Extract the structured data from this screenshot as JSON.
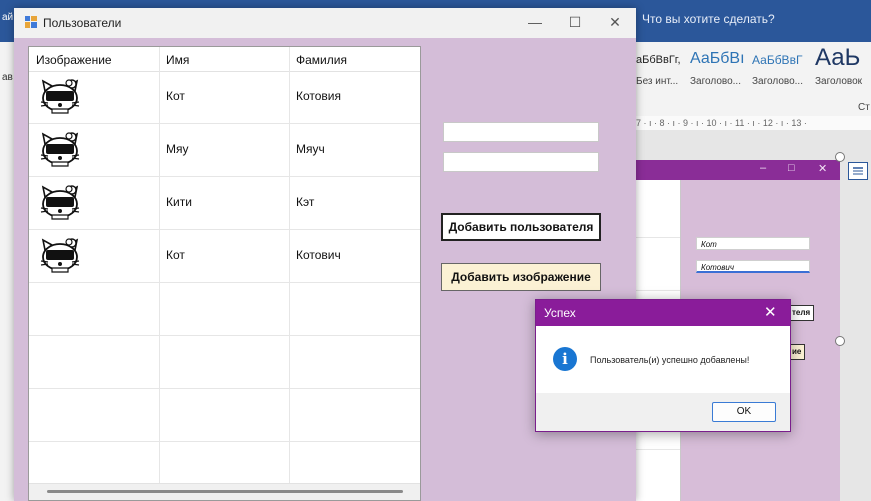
{
  "word": {
    "search_placeholder": "Что вы хотите сделать?",
    "left_labels": [
      "ай",
      "ав"
    ],
    "styles": [
      {
        "sample": "аБбВвГг,",
        "name": "Без инт..."
      },
      {
        "sample": "АаБбВı",
        "name": "Заголово..."
      },
      {
        "sample": "АаБбВвГ",
        "name": "Заголово..."
      },
      {
        "sample": "АаЬ",
        "name": "Заголовок"
      }
    ],
    "ribbon_right_label": "Ст",
    "ruler_text": "7 · ı · 8 · ı · 9 · ı · 10 · ı · 11 · ı · 12 · ı · 13 ·",
    "embedded": {
      "controls": [
        "–",
        "□",
        "✕"
      ],
      "first_name": "Кот",
      "last_name": "Котович",
      "btn1_fragment": "теля",
      "btn2_fragment": "ие"
    }
  },
  "window": {
    "title": "Пользователи",
    "controls": {
      "minimize": "—",
      "maximize": "☐",
      "close": "✕"
    },
    "grid": {
      "headers": [
        "Изображение",
        "Имя",
        "Фамилия"
      ],
      "rows": [
        {
          "image": "hello-kitty-sunglasses-icon",
          "first": "Кот",
          "last": "Котовия"
        },
        {
          "image": "hello-kitty-sunglasses-icon",
          "first": "Мяу",
          "last": "Мяуч"
        },
        {
          "image": "hello-kitty-sunglasses-icon",
          "first": "Кити",
          "last": "Кэт"
        },
        {
          "image": "hello-kitty-sunglasses-icon",
          "first": "Кот",
          "last": "Котович"
        }
      ]
    },
    "first_name_input": "",
    "last_name_input": "",
    "add_user_button": "Добавить пользователя",
    "add_image_button": "Добавить изображение"
  },
  "message_box": {
    "title": "Успех",
    "close": "✕",
    "icon": "info-icon",
    "text": "Пользователь(и) успешно добавлены!",
    "ok": "OK"
  },
  "colors": {
    "word_blue": "#2b579a",
    "window_bg": "#d4bdd8",
    "dialog_title": "#8a1c9a",
    "add_image_bg": "#fbf1d4"
  }
}
